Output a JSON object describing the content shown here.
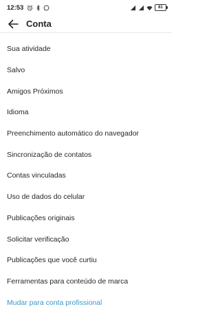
{
  "status_bar": {
    "time": "12:53",
    "left_icons": [
      "alarm-icon",
      "bluetooth-icon",
      "whatsapp-icon"
    ],
    "right_icons": [
      "signal-icon",
      "signal-icon",
      "wifi-icon",
      "battery-icon"
    ],
    "battery": "81"
  },
  "header": {
    "title": "Conta",
    "back_icon": "arrow-back-icon"
  },
  "menu": [
    {
      "label": "Sua atividade"
    },
    {
      "label": "Salvo"
    },
    {
      "label": "Amigos Próximos"
    },
    {
      "label": "Idioma"
    },
    {
      "label": "Preenchimento automático do navegador"
    },
    {
      "label": "Sincronização de contatos"
    },
    {
      "label": "Contas vinculadas"
    },
    {
      "label": "Uso de dados do celular"
    },
    {
      "label": "Publicações originais"
    },
    {
      "label": "Solicitar verificação"
    },
    {
      "label": "Publicações que você curtiu"
    },
    {
      "label": "Ferramentas para conteúdo de marca"
    },
    {
      "label": "Mudar para conta profissional"
    }
  ],
  "colors": {
    "text": "#262626",
    "link": "#3a97c9",
    "background": "#ffffff"
  }
}
